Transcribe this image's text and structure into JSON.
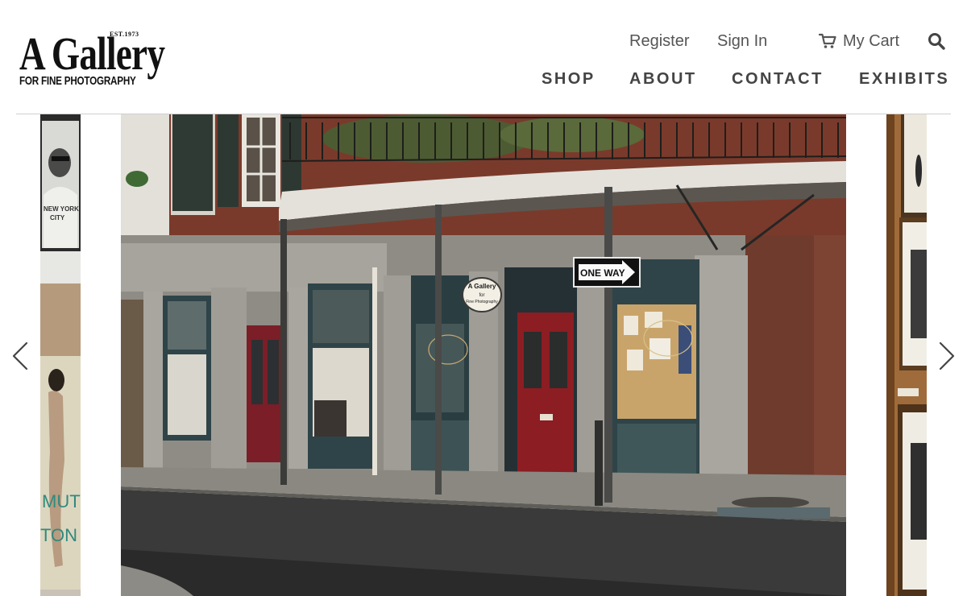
{
  "brand": {
    "est": "EST.1973",
    "name": "A Gallery",
    "tagline": "FOR FINE PHOTOGRAPHY"
  },
  "utility_nav": {
    "register": "Register",
    "sign_in": "Sign In",
    "cart": "My Cart",
    "cart_icon": "shopping-cart-icon",
    "search_icon": "search-icon"
  },
  "main_nav": {
    "shop": "SHOP",
    "about": "ABOUT",
    "contact": "CONTACT",
    "exhibits": "EXHIBITS"
  },
  "slider": {
    "prev_icon": "chevron-left-icon",
    "next_icon": "chevron-right-icon",
    "main_slide": {
      "street_sign": "ONE WAY",
      "shop_sign_line1": "A Gallery",
      "shop_sign_line2": "for",
      "shop_sign_line3": "Fine Photography"
    },
    "left_slide": {
      "poster_text_1": "NEW YORK",
      "poster_text_2": "CITY",
      "poster_text_3": "MUT",
      "poster_text_4": "TON"
    }
  },
  "colors": {
    "nav_text": "#444444",
    "util_text": "#555555",
    "divider": "#cfcfcf",
    "door_red": "#8c1d22",
    "brick": "#7a3a2b"
  }
}
